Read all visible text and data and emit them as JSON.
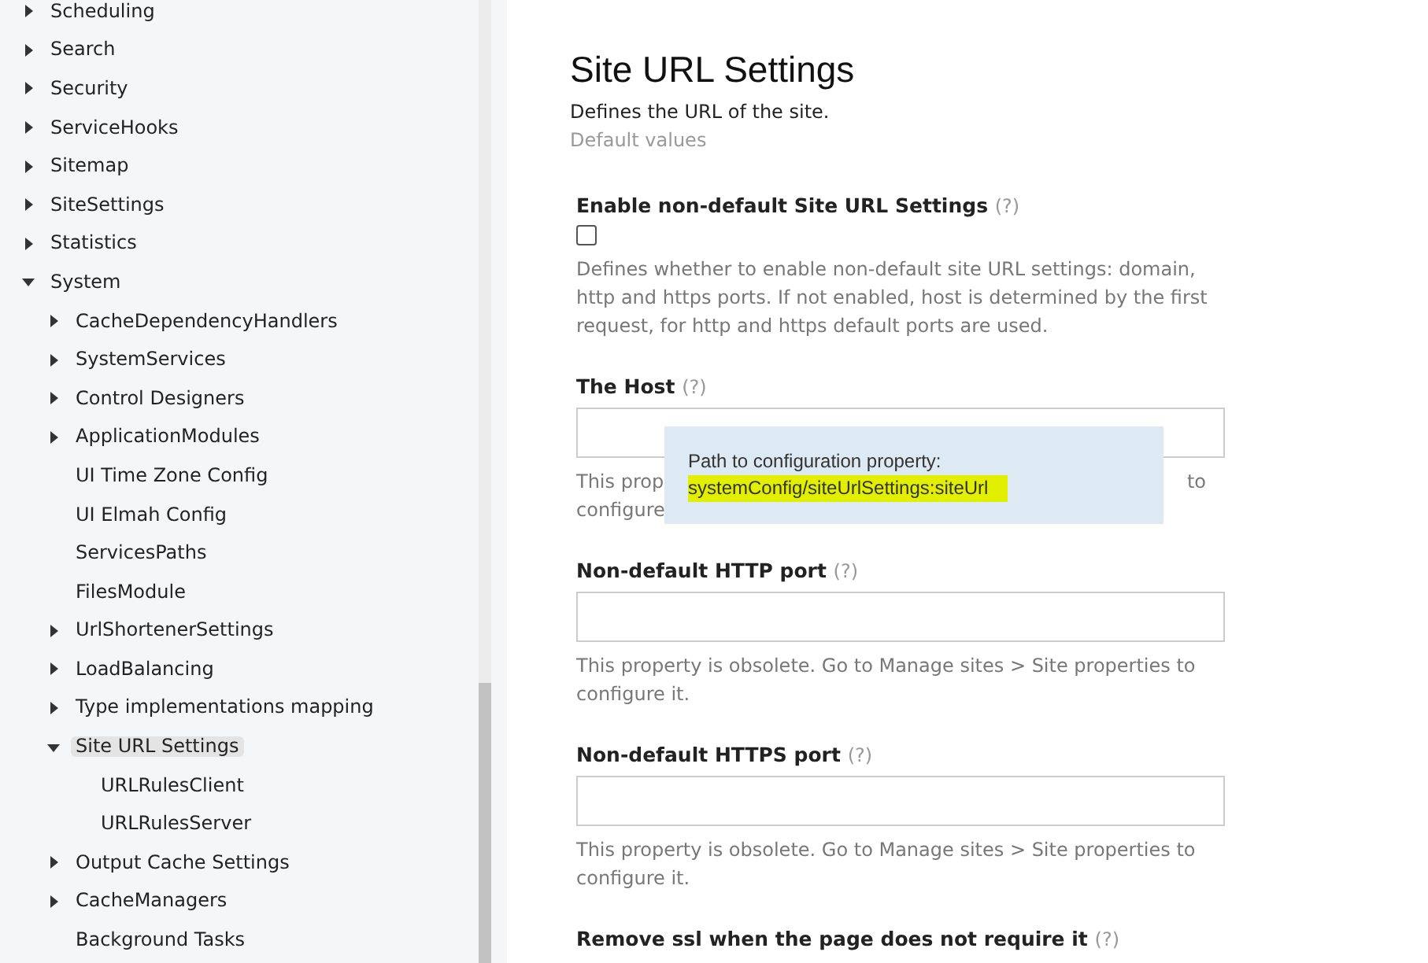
{
  "sidebar": {
    "tree": [
      {
        "label": "Scheduling",
        "kind": "branch",
        "expanded": false,
        "selected": false
      },
      {
        "label": "Search",
        "kind": "branch",
        "expanded": false,
        "selected": false
      },
      {
        "label": "Security",
        "kind": "branch",
        "expanded": false,
        "selected": false
      },
      {
        "label": "ServiceHooks",
        "kind": "branch",
        "expanded": false,
        "selected": false
      },
      {
        "label": "Sitemap",
        "kind": "branch",
        "expanded": false,
        "selected": false
      },
      {
        "label": "SiteSettings",
        "kind": "branch",
        "expanded": false,
        "selected": false
      },
      {
        "label": "Statistics",
        "kind": "branch",
        "expanded": false,
        "selected": false
      },
      {
        "label": "System",
        "kind": "branch",
        "expanded": true,
        "selected": false,
        "children": [
          {
            "label": "CacheDependencyHandlers",
            "kind": "branch",
            "expanded": false,
            "selected": false
          },
          {
            "label": "SystemServices",
            "kind": "branch",
            "expanded": false,
            "selected": false
          },
          {
            "label": "Control Designers",
            "kind": "branch",
            "expanded": false,
            "selected": false
          },
          {
            "label": "ApplicationModules",
            "kind": "branch",
            "expanded": false,
            "selected": false
          },
          {
            "label": "UI Time Zone Config",
            "kind": "leaf",
            "selected": false
          },
          {
            "label": "UI Elmah Config",
            "kind": "leaf",
            "selected": false
          },
          {
            "label": "ServicesPaths",
            "kind": "leaf",
            "selected": false
          },
          {
            "label": "FilesModule",
            "kind": "leaf",
            "selected": false
          },
          {
            "label": "UrlShortenerSettings",
            "kind": "branch",
            "expanded": false,
            "selected": false
          },
          {
            "label": "LoadBalancing",
            "kind": "branch",
            "expanded": false,
            "selected": false
          },
          {
            "label": "Type implementations mapping",
            "kind": "branch",
            "expanded": false,
            "selected": false
          },
          {
            "label": "Site URL Settings",
            "kind": "branch",
            "expanded": true,
            "selected": true,
            "children": [
              {
                "label": "URLRulesClient",
                "kind": "leaf",
                "selected": false
              },
              {
                "label": "URLRulesServer",
                "kind": "leaf",
                "selected": false
              }
            ]
          },
          {
            "label": "Output Cache Settings",
            "kind": "branch",
            "expanded": false,
            "selected": false
          },
          {
            "label": "CacheManagers",
            "kind": "branch",
            "expanded": false,
            "selected": false
          },
          {
            "label": "Background Tasks",
            "kind": "leaf",
            "selected": false
          }
        ]
      }
    ]
  },
  "main": {
    "title": "Site URL Settings",
    "subtitle": "Defines the URL of the site.",
    "default_values_link": "Default values",
    "fields": [
      {
        "kind": "checkbox",
        "label": "Enable non-default Site URL Settings",
        "help": "(?)",
        "checked": false,
        "description": [
          "Defines whether to enable non-default site URL settings: domain, http and https ports. If not enabled, host is determined by the first request, for http and https default ports are used."
        ]
      },
      {
        "kind": "text",
        "label": "The Host",
        "help": "(?)",
        "description": [
          "This prop",
          "to",
          "configure"
        ]
      },
      {
        "kind": "text",
        "label": "Non-default HTTP port",
        "help": "(?)",
        "description": [
          "This property is obsolete. Go to Manage sites > Site properties to configure it."
        ]
      },
      {
        "kind": "text",
        "label": "Non-default HTTPS port",
        "help": "(?)",
        "description": [
          "This property is obsolete. Go to Manage sites > Site properties to configure it."
        ]
      },
      {
        "kind": "checkbox_cut",
        "label": "Remove ssl when the page does not require it",
        "help": "(?)"
      }
    ]
  },
  "tooltip": {
    "caption": "Path to configuration property:",
    "path": "systemConfig/siteUrlSettings:siteUrl"
  }
}
